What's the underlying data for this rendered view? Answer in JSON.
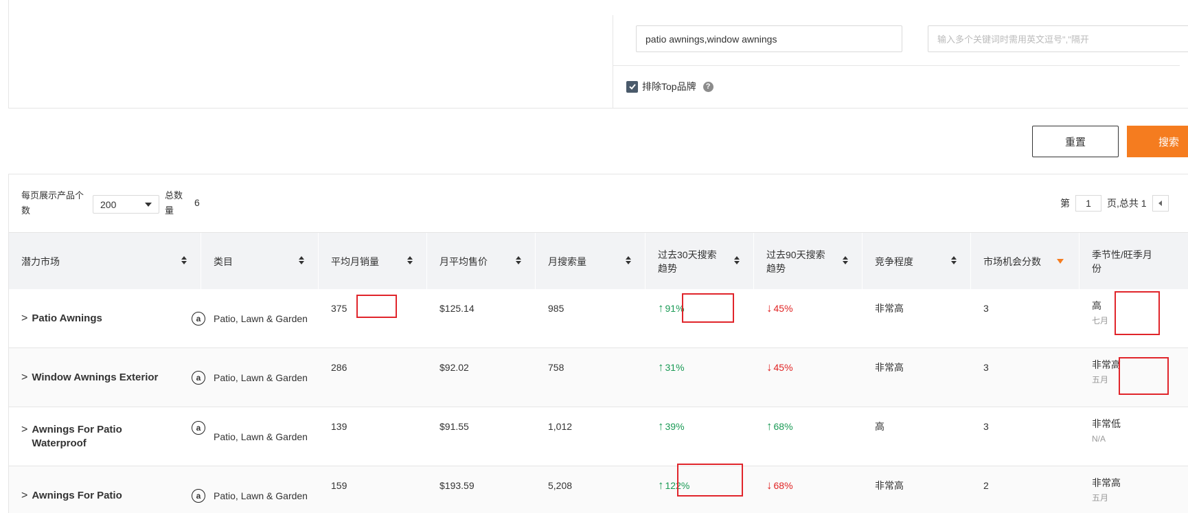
{
  "filters": {
    "keyword_value": "patio awnings,window awnings",
    "extra_keyword_placeholder": "输入多个关键词时需用英文逗号\",\"隔开",
    "exclude_top_brand_label": "排除Top品牌",
    "exclude_top_brand_checked": true,
    "help_symbol": "?"
  },
  "buttons": {
    "reset_label": "重置",
    "search_label": "搜索"
  },
  "toolbar": {
    "per_page_label": "每页展示产品个数",
    "per_page_value": "200",
    "total_label": "总数量",
    "total_value": "6",
    "page_prefix": "第",
    "page_current": "1",
    "page_suffix": "页,总共 1"
  },
  "table": {
    "columns": [
      {
        "label": "潜力市场",
        "sortable": true
      },
      {
        "label": "类目",
        "sortable": true
      },
      {
        "label": "平均月销量",
        "sortable": true
      },
      {
        "label": "月平均售价",
        "sortable": true
      },
      {
        "label": "月搜索量",
        "sortable": true
      },
      {
        "label": "过去30天搜索趋势",
        "sortable": true
      },
      {
        "label": "过去90天搜索趋势",
        "sortable": true
      },
      {
        "label": "竞争程度",
        "sortable": true
      },
      {
        "label": "市场机会分数",
        "sortable": "active"
      },
      {
        "label": "季节性/旺季月份",
        "sortable": false
      }
    ],
    "rows": [
      {
        "market": "Patio Awnings",
        "category": "Patio, Lawn & Garden",
        "avg_sales": "375",
        "avg_price": "$125.14",
        "search_volume": "985",
        "trend30": "91%",
        "trend30_dir": "up",
        "trend90": "45%",
        "trend90_dir": "down",
        "competition": "非常高",
        "score": "3",
        "season_level": "高",
        "season_month": "七月"
      },
      {
        "market": "Window Awnings Exterior",
        "category": "Patio, Lawn & Garden",
        "avg_sales": "286",
        "avg_price": "$92.02",
        "search_volume": "758",
        "trend30": "31%",
        "trend30_dir": "up",
        "trend90": "45%",
        "trend90_dir": "down",
        "competition": "非常高",
        "score": "3",
        "season_level": "非常高",
        "season_month": "五月"
      },
      {
        "market": "Awnings For Patio Waterproof",
        "category": "Patio, Lawn & Garden",
        "avg_sales": "139",
        "avg_price": "$91.55",
        "search_volume": "1,012",
        "trend30": "39%",
        "trend30_dir": "up",
        "trend90": "68%",
        "trend90_dir": "up",
        "competition": "高",
        "score": "3",
        "season_level": "非常低",
        "season_month": "N/A"
      },
      {
        "market": "Awnings For Patio",
        "category": "Patio, Lawn & Garden",
        "avg_sales": "159",
        "avg_price": "$193.59",
        "search_volume": "5,208",
        "trend30": "122%",
        "trend30_dir": "up",
        "trend90": "68%",
        "trend90_dir": "down",
        "competition": "非常高",
        "score": "2",
        "season_level": "非常高",
        "season_month": "五月"
      }
    ]
  }
}
